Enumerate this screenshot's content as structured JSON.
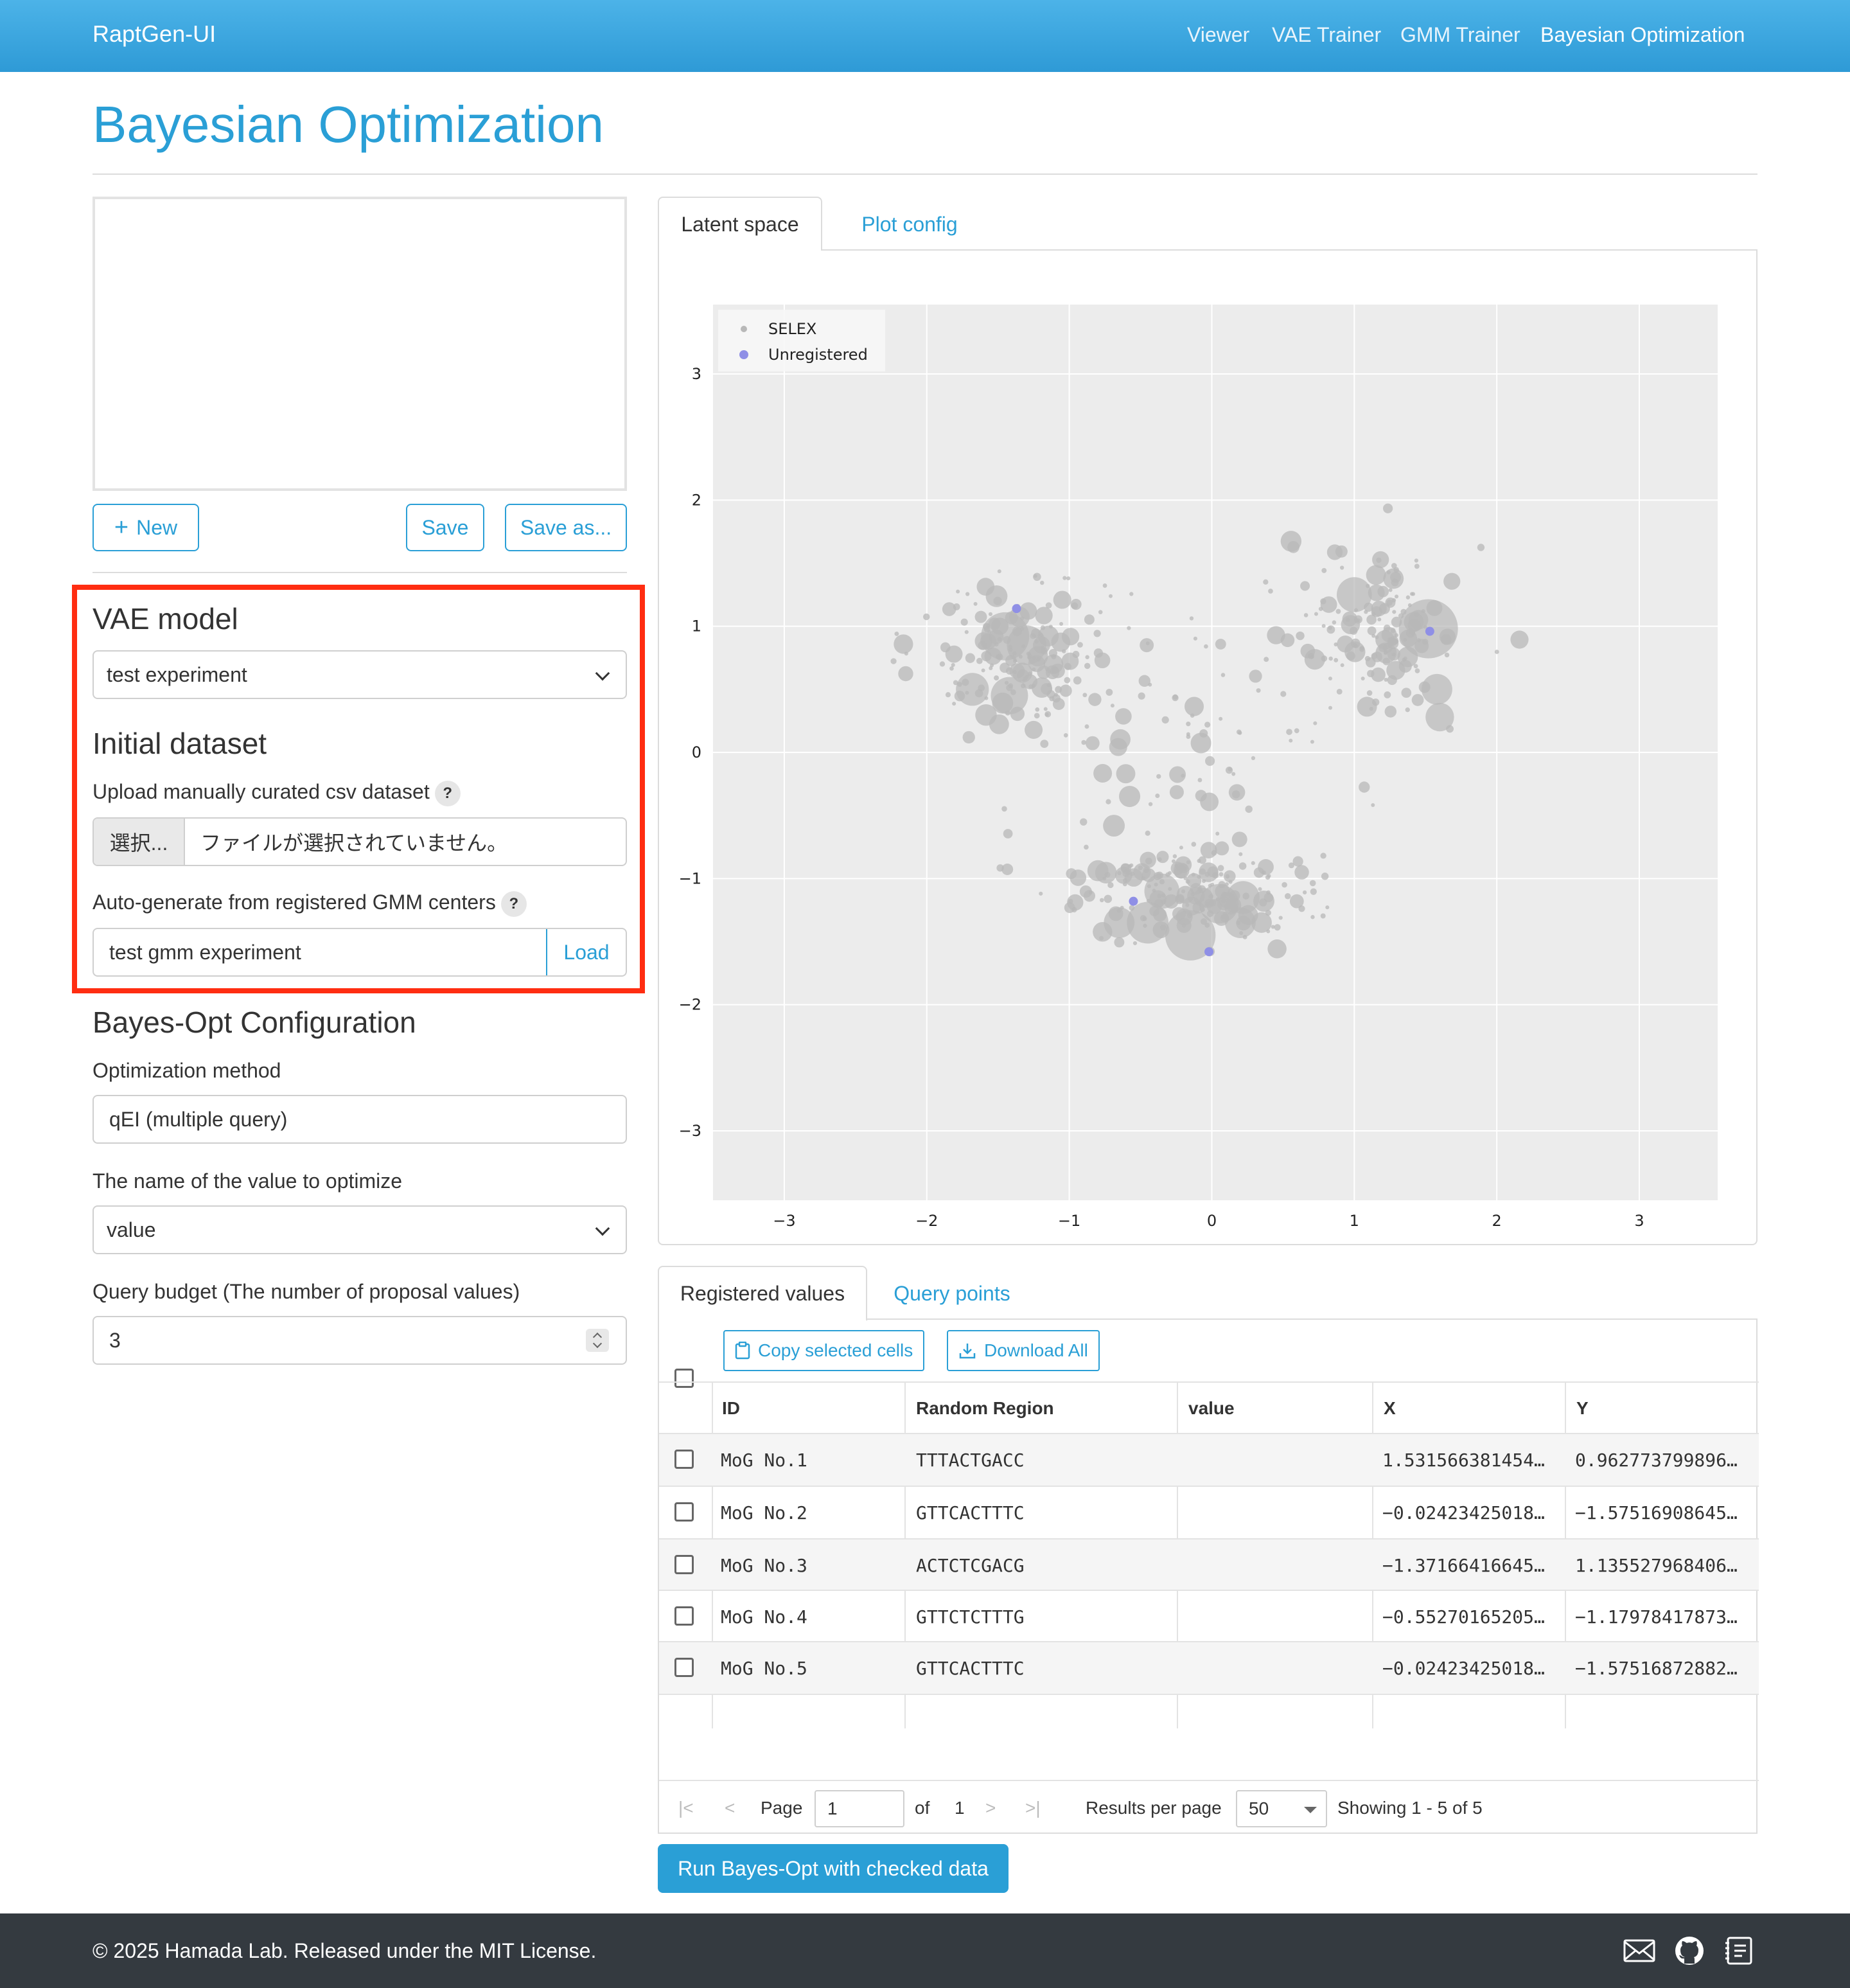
{
  "navbar": {
    "brand": "RaptGen-UI",
    "links": [
      {
        "label": "Viewer"
      },
      {
        "label": "VAE Trainer"
      },
      {
        "label": "GMM Trainer"
      },
      {
        "label": "Bayesian Optimization"
      }
    ]
  },
  "page": {
    "title": "Bayesian Optimization"
  },
  "editor": {
    "new_label": "New",
    "save_label": "Save",
    "save_as_label": "Save as..."
  },
  "vae": {
    "heading": "VAE model",
    "selected": "test experiment"
  },
  "initial_dataset": {
    "heading": "Initial dataset",
    "upload_label": "Upload manually curated csv dataset",
    "help": "?",
    "file_button": "選択...",
    "file_status": "ファイルが選択されていません。",
    "autogen_label": "Auto-generate from registered GMM centers",
    "gmm_value": "test gmm experiment",
    "load_label": "Load"
  },
  "bayes_config": {
    "heading": "Bayes-Opt Configuration",
    "method_label": "Optimization method",
    "method_value": "qEI (multiple query)",
    "target_label": "The name of the value to optimize",
    "target_value": "value",
    "budget_label": "Query budget (The number of proposal values)",
    "budget_value": "3"
  },
  "plot_tabs": [
    {
      "label": "Latent space",
      "active": true
    },
    {
      "label": "Plot config",
      "active": false
    }
  ],
  "chart_data": {
    "type": "scatter",
    "xlim": [
      -3.5,
      3.55
    ],
    "ylim": [
      -3.55,
      3.55
    ],
    "x_ticks": [
      "−3",
      "−2",
      "−1",
      "0",
      "1",
      "2",
      "3"
    ],
    "y_ticks": [
      "3",
      "2",
      "1",
      "0",
      "−1",
      "−2",
      "−3"
    ],
    "legend_position": "top-left",
    "grid": true,
    "series": [
      {
        "name": "SELEX",
        "color": "#b8b8b8",
        "clusters": [
          {
            "center": [
              -1.3,
              0.75
            ],
            "spread": [
              0.35,
              0.28
            ],
            "count": 170
          },
          {
            "center": [
              1.15,
              0.95
            ],
            "spread": [
              0.32,
              0.32
            ],
            "count": 160
          },
          {
            "center": [
              -0.1,
              -1.1
            ],
            "spread": [
              0.42,
              0.2
            ],
            "count": 190
          },
          {
            "center": [
              -0.3,
              -0.05
            ],
            "spread": [
              0.55,
              0.45
            ],
            "count": 70
          }
        ],
        "large_points": [
          {
            "x": 1.52,
            "y": 0.98,
            "r": 1.0
          },
          {
            "x": -1.45,
            "y": 0.92,
            "r": 0.75
          },
          {
            "x": 1.0,
            "y": 1.25,
            "r": 0.45
          },
          {
            "x": -0.15,
            "y": -1.45,
            "r": 0.8
          },
          {
            "x": -0.45,
            "y": -1.35,
            "r": 0.6
          },
          {
            "x": -1.42,
            "y": 0.45,
            "r": 0.5
          },
          {
            "x": -1.68,
            "y": 0.5,
            "r": 0.4
          },
          {
            "x": 0.05,
            "y": -1.2,
            "r": 0.55
          },
          {
            "x": -0.35,
            "y": -1.1,
            "r": 0.45
          },
          {
            "x": 0.22,
            "y": -1.15,
            "r": 0.4
          },
          {
            "x": 1.58,
            "y": 0.5,
            "r": 0.35
          },
          {
            "x": 1.6,
            "y": 0.28,
            "r": 0.3
          },
          {
            "x": -0.65,
            "y": -1.35,
            "r": 0.35
          },
          {
            "x": -1.3,
            "y": 0.85,
            "r": 0.55
          },
          {
            "x": 0.2,
            "y": -1.35,
            "r": 0.35
          }
        ]
      },
      {
        "name": "Unregistered",
        "color": "#8f8fe6",
        "points": [
          {
            "x": 1.53,
            "y": 0.96
          },
          {
            "x": -1.37,
            "y": 1.14
          },
          {
            "x": -0.55,
            "y": -1.18
          },
          {
            "x": -0.02,
            "y": -1.58
          }
        ]
      }
    ]
  },
  "table_tabs": [
    {
      "label": "Registered values",
      "active": true
    },
    {
      "label": "Query points",
      "active": false
    }
  ],
  "table": {
    "copy_label": "Copy selected cells",
    "download_label": "Download All",
    "columns": [
      "ID",
      "Random Region",
      "value",
      "X",
      "Y"
    ],
    "rows": [
      {
        "id": "MoG No.1",
        "region": "TTTACTGACC",
        "value": "",
        "x": "1.531566381454…",
        "y": "0.962773799896…"
      },
      {
        "id": "MoG No.2",
        "region": "GTTCACTTTC",
        "value": "",
        "x": "−0.02423425018…",
        "y": "−1.57516908645…"
      },
      {
        "id": "MoG No.3",
        "region": "ACTCTCGACG",
        "value": "",
        "x": "−1.37166416645…",
        "y": "1.135527968406…"
      },
      {
        "id": "MoG No.4",
        "region": "GTTCTCTTTG",
        "value": "",
        "x": "−0.55270165205…",
        "y": "−1.17978417873…"
      },
      {
        "id": "MoG No.5",
        "region": "GTTCACTTTC",
        "value": "",
        "x": "−0.02423425018…",
        "y": "−1.57516872882…"
      }
    ],
    "pager": {
      "page_label": "Page",
      "page_value": "1",
      "of_label": "of",
      "total_pages": "1",
      "per_page_label": "Results per page",
      "per_page_value": "50",
      "showing": "Showing 1 - 5 of 5"
    }
  },
  "run_button": "Run Bayes-Opt with checked data",
  "footer": {
    "text": "© 2025 Hamada Lab. Released under the MIT License.",
    "icons": [
      "mail-icon",
      "github-icon",
      "document-icon"
    ]
  }
}
